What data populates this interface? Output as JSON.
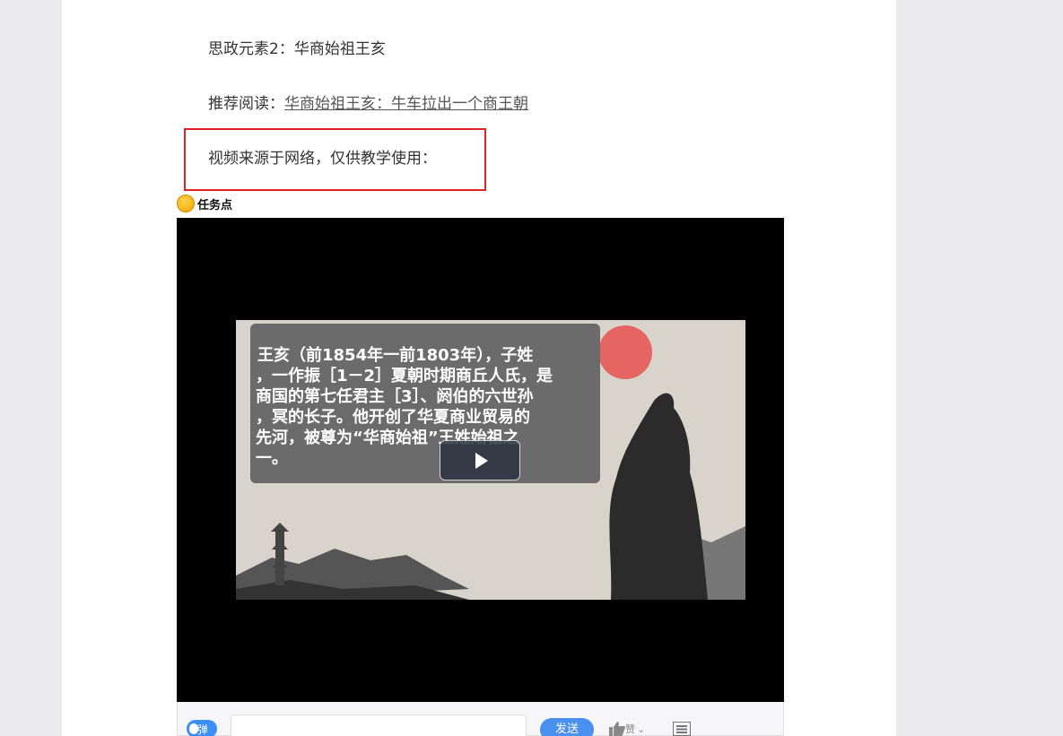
{
  "content": {
    "line1": "思政元素2：华商始祖王亥",
    "line2_prefix": "推荐阅读：",
    "line2_link": "华商始祖王亥：牛车拉出一个商王朝",
    "line3": "视频来源于网络，仅供教学使用："
  },
  "task": {
    "label": "任务点",
    "icon": "coin-icon"
  },
  "video": {
    "caption_lines": [
      "王亥（前1854年一前1803年），子姓",
      "，一作振［1－2］夏朝时期商丘人氏，是",
      "商国的第七任君主［3］、阏伯的六世孙",
      "，冥的长子。他开创了华夏商业贸易的",
      "先河，被尊为“华商始祖”王姓始祖之",
      "一。"
    ],
    "play_icon": "play-icon"
  },
  "controls": {
    "danmu_label": "弹",
    "send_label": "发送",
    "like_label": "赞",
    "like_icon": "thumbs-up-icon",
    "menu_icon": "list-icon"
  },
  "colors": {
    "highlight_box": "#e02424",
    "send_button": "#4a90f0",
    "danmu_toggle": "#3a8ef6"
  }
}
